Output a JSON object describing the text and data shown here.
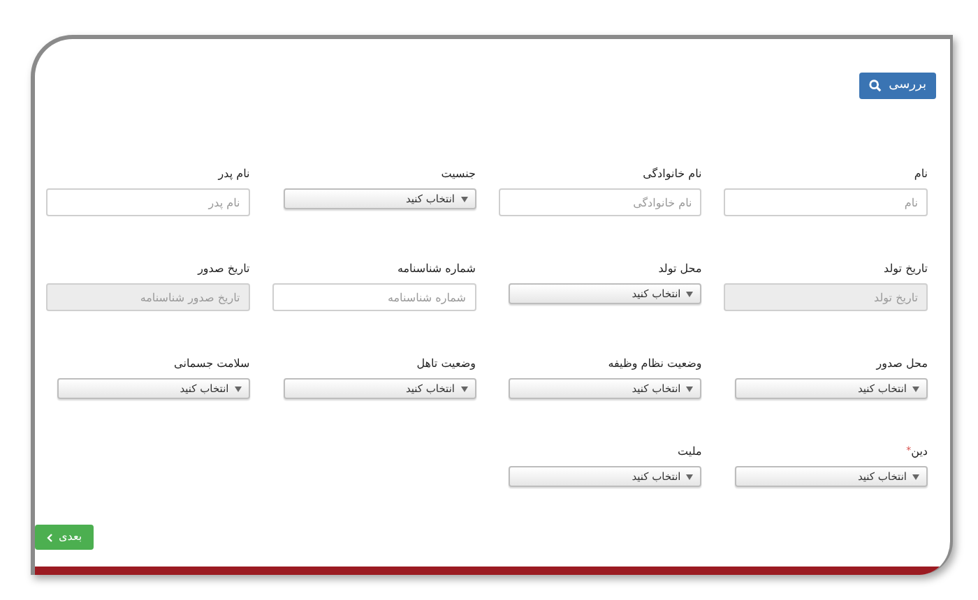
{
  "search_button": {
    "label": "بررسی"
  },
  "fields": [
    {
      "kind": "text",
      "label": "نام",
      "placeholder": "نام"
    },
    {
      "kind": "text",
      "label": "نام خانوادگی",
      "placeholder": "نام خانوادگی"
    },
    {
      "kind": "select",
      "label": "جنسیت",
      "value": "انتخاب کنید"
    },
    {
      "kind": "text",
      "label": "نام پدر",
      "placeholder": "نام پدر"
    },
    {
      "kind": "date",
      "label": "تاریخ تولد",
      "placeholder": "تاریخ تولد"
    },
    {
      "kind": "select",
      "label": "محل تولد",
      "value": "انتخاب کنید"
    },
    {
      "kind": "text",
      "label": "شماره شناسنامه",
      "placeholder": "شماره شناسنامه"
    },
    {
      "kind": "date",
      "label": "تاریخ صدور",
      "placeholder": "تاریخ صدور شناسنامه"
    },
    {
      "kind": "select",
      "label": "محل صدور",
      "value": "انتخاب کنید"
    },
    {
      "kind": "select",
      "label": "وضعیت نظام وظیفه",
      "value": "انتخاب کنید"
    },
    {
      "kind": "select",
      "label": "وضعیت تاهل",
      "value": "انتخاب کنید"
    },
    {
      "kind": "select",
      "label": "سلامت جسمانی",
      "value": "انتخاب کنید"
    },
    {
      "kind": "select",
      "label": "دین",
      "required_mark": "*",
      "value": "انتخاب کنید"
    },
    {
      "kind": "select",
      "label": "ملیت",
      "value": "انتخاب کنید"
    }
  ],
  "next_button": {
    "label": "بعدی"
  }
}
